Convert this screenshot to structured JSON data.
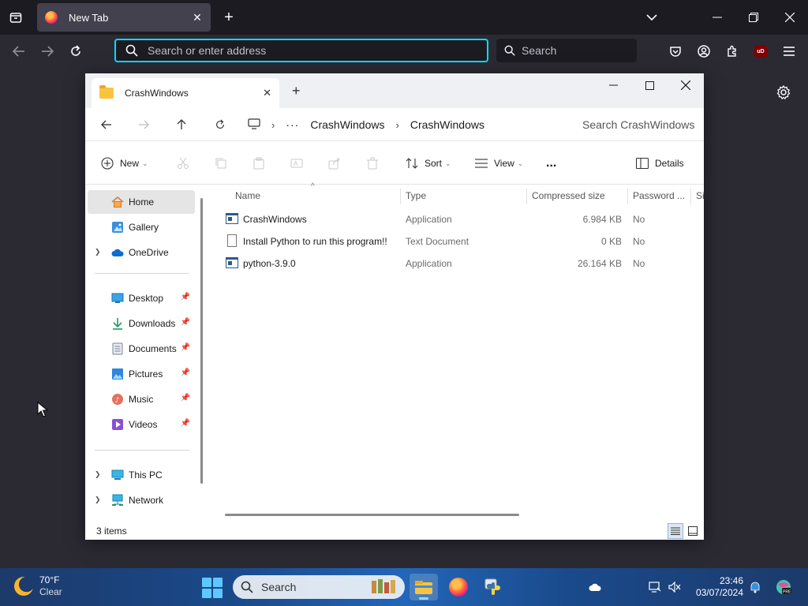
{
  "browser": {
    "tab_title": "New Tab",
    "url_placeholder": "Search or enter address",
    "search_placeholder": "Search"
  },
  "explorer": {
    "tab_title": "CrashWindows",
    "breadcrumb": [
      "CrashWindows",
      "CrashWindows"
    ],
    "search_placeholder": "Search CrashWindows",
    "commands": {
      "new": "New",
      "sort": "Sort",
      "view": "View",
      "more": "...",
      "details": "Details"
    },
    "sidebar": {
      "items": [
        {
          "label": "Home"
        },
        {
          "label": "Gallery"
        },
        {
          "label": "OneDrive"
        },
        {
          "label": "Desktop"
        },
        {
          "label": "Downloads"
        },
        {
          "label": "Documents"
        },
        {
          "label": "Pictures"
        },
        {
          "label": "Music"
        },
        {
          "label": "Videos"
        },
        {
          "label": "This PC"
        },
        {
          "label": "Network"
        }
      ]
    },
    "columns": [
      "Name",
      "Type",
      "Compressed size",
      "Password ...",
      "Si"
    ],
    "files": [
      {
        "name": "CrashWindows",
        "type": "Application",
        "size": "6.984 KB",
        "password": "No"
      },
      {
        "name": "Install Python to run this program!!",
        "type": "Text Document",
        "size": "0 KB",
        "password": "No"
      },
      {
        "name": "python-3.9.0",
        "type": "Application",
        "size": "26.164 KB",
        "password": "No"
      }
    ],
    "status": "3 items"
  },
  "taskbar": {
    "weather_temp": "70°F",
    "weather_cond": "Clear",
    "search_label": "Search",
    "time": "23:46",
    "date": "03/07/2024"
  }
}
